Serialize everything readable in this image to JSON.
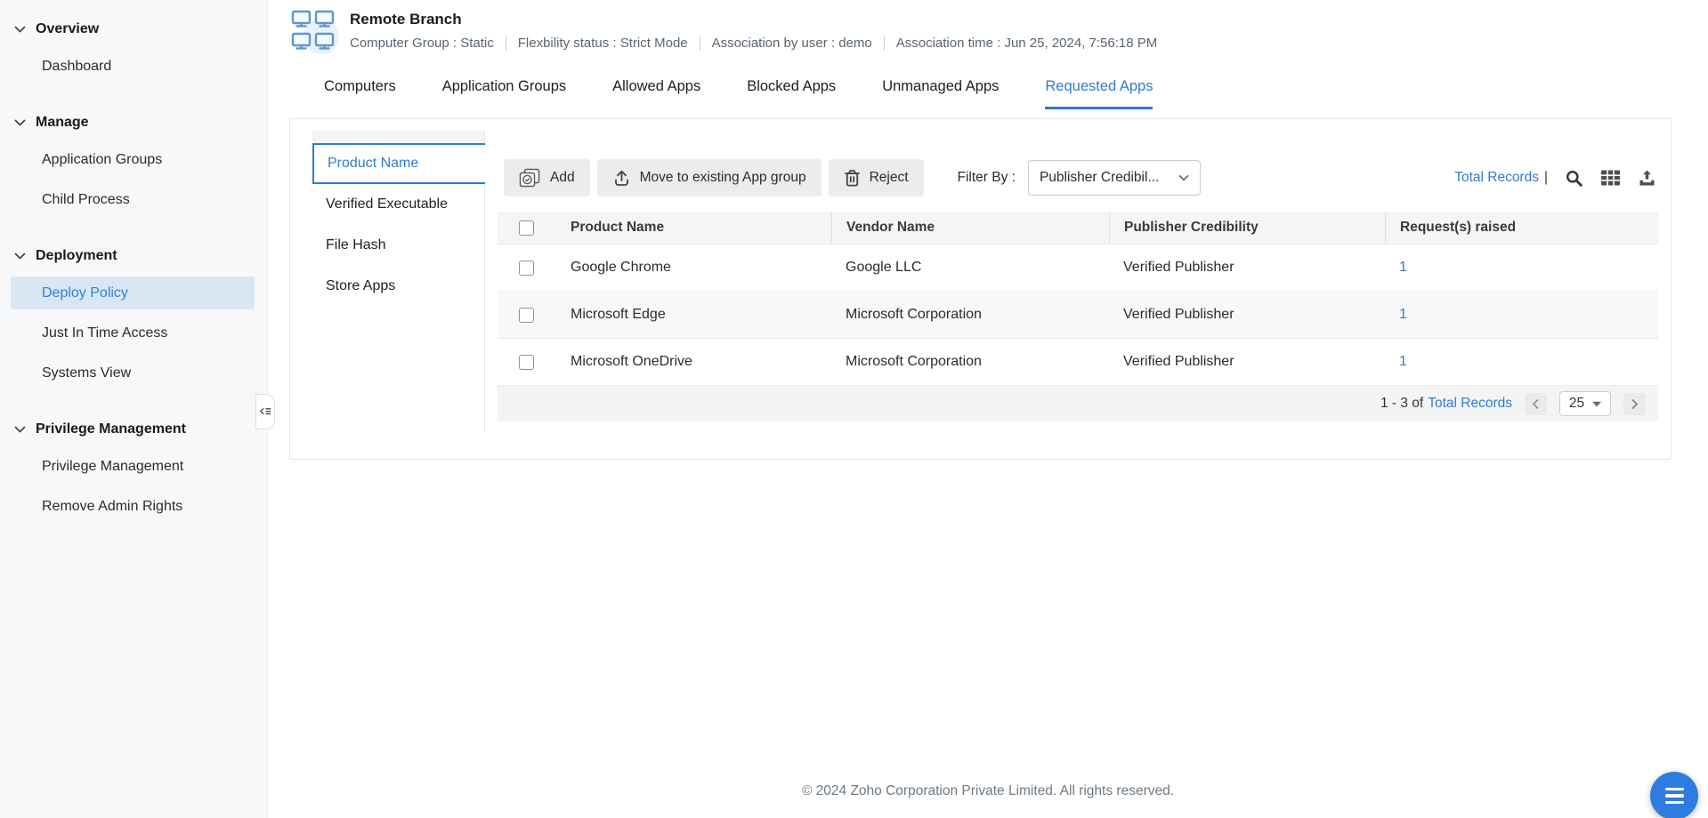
{
  "colors": {
    "accent": "#2f7cd3",
    "active_nav_bg": "#d9e6f4",
    "fab_blue": "#2e7ce0"
  },
  "sidebar": {
    "sections": [
      {
        "label": "Overview",
        "items": [
          {
            "label": "Dashboard"
          }
        ]
      },
      {
        "label": "Manage",
        "items": [
          {
            "label": "Application Groups"
          },
          {
            "label": "Child Process"
          }
        ]
      },
      {
        "label": "Deployment",
        "items": [
          {
            "label": "Deploy Policy"
          },
          {
            "label": "Just In Time Access"
          },
          {
            "label": "Systems View"
          }
        ]
      },
      {
        "label": "Privilege Management",
        "items": [
          {
            "label": "Privilege Management"
          },
          {
            "label": "Remove Admin Rights"
          }
        ]
      }
    ],
    "active_item": "Deploy Policy"
  },
  "header": {
    "title": "Remote Branch",
    "meta": [
      "Computer Group : Static",
      "Flexbility status : Strict Mode",
      "Association by user : demo",
      "Association time : Jun 25, 2024, 7:56:18 PM"
    ]
  },
  "tabs": {
    "items": [
      "Computers",
      "Application Groups",
      "Allowed Apps",
      "Blocked Apps",
      "Unmanaged Apps",
      "Requested Apps"
    ],
    "active": "Requested Apps"
  },
  "subnav": {
    "items": [
      "Product Name",
      "Verified Executable",
      "File Hash",
      "Store Apps"
    ],
    "active": "Product Name"
  },
  "toolbar": {
    "add": "Add",
    "move": "Move to existing App group",
    "reject": "Reject",
    "filter_label": "Filter By :",
    "filter_value": "Publisher Credibil...",
    "total_records": "Total Records",
    "separator": "|"
  },
  "table": {
    "columns": [
      "Product Name",
      "Vendor Name",
      "Publisher Credibility",
      "Request(s) raised"
    ],
    "rows": [
      {
        "product": "Google Chrome",
        "vendor": "Google LLC",
        "credibility": "Verified Publisher",
        "requests": "1"
      },
      {
        "product": "Microsoft Edge",
        "vendor": "Microsoft Corporation",
        "credibility": "Verified Publisher",
        "requests": "1"
      },
      {
        "product": "Microsoft OneDrive",
        "vendor": "Microsoft Corporation",
        "credibility": "Verified Publisher",
        "requests": "1"
      }
    ]
  },
  "pagination": {
    "range": "1 - 3 of",
    "total_link": "Total Records",
    "page_size": "25"
  },
  "footer": {
    "copyright": "© 2024 Zoho Corporation Private Limited. All rights reserved."
  }
}
